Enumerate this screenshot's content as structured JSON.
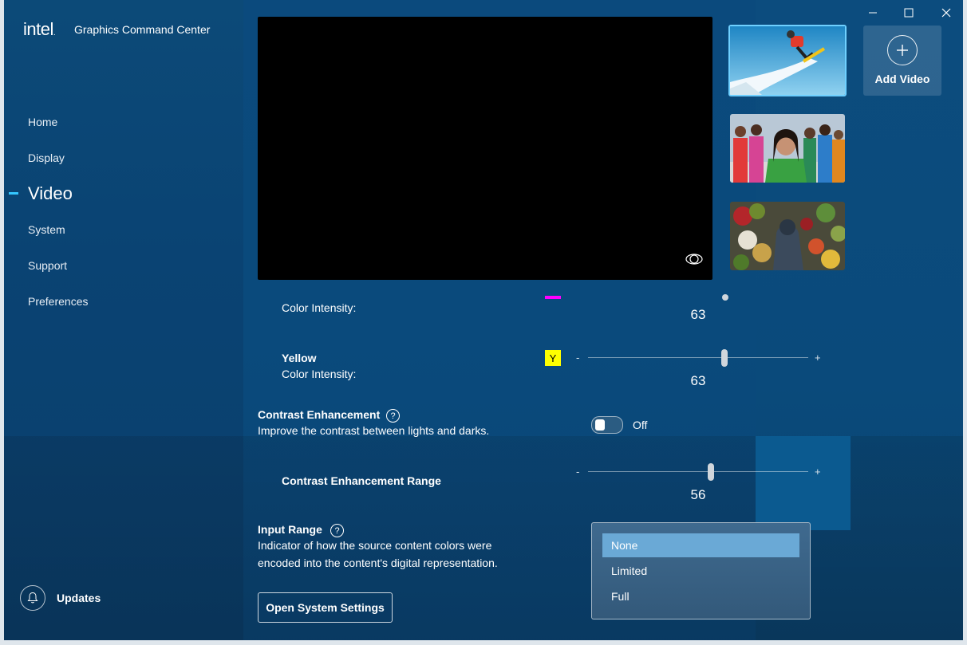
{
  "app": {
    "logo": "intel",
    "title": "Graphics Command Center"
  },
  "nav": {
    "items": [
      {
        "label": "Home"
      },
      {
        "label": "Display"
      },
      {
        "label": "Video"
      },
      {
        "label": "System"
      },
      {
        "label": "Support"
      },
      {
        "label": "Preferences"
      }
    ],
    "active": "Video"
  },
  "updates": {
    "label": "Updates",
    "icon": "bell-icon"
  },
  "window_controls": {
    "minimize": "–",
    "maximize": "□",
    "close": "✕"
  },
  "preview": {
    "icon": "eye-icon"
  },
  "thumbnails": [
    {
      "name": "snowboarder",
      "selected": true
    },
    {
      "name": "group-of-people",
      "selected": false
    },
    {
      "name": "market-vendor",
      "selected": false
    }
  ],
  "add_video": {
    "label": "Add Video",
    "icon": "plus-icon"
  },
  "magenta": {
    "intensity_label": "Color Intensity:",
    "value": "63",
    "slider_fraction": 0.63,
    "color": "#ff00ff"
  },
  "yellow": {
    "name": "Yellow",
    "intensity_label": "Color Intensity:",
    "swatch_letter": "Y",
    "value": "63",
    "slider_fraction": 0.63,
    "minus": "-",
    "plus": "+",
    "color": "#ffff00"
  },
  "contrast_enhancement": {
    "title": "Contrast Enhancement",
    "help": "?",
    "description": "Improve the contrast between lights and darks.",
    "toggle_state": "Off"
  },
  "contrast_range": {
    "title": "Contrast Enhancement Range",
    "value": "56",
    "slider_fraction": 0.56,
    "minus": "-",
    "plus": "+"
  },
  "input_range": {
    "title": "Input Range",
    "help": "?",
    "description_line1": "Indicator of how the source content colors were",
    "description_line2": "encoded into the content's digital representation.",
    "options": [
      {
        "label": "None",
        "selected": true
      },
      {
        "label": "Limited",
        "selected": false
      },
      {
        "label": "Full",
        "selected": false
      }
    ]
  },
  "open_system_settings": {
    "label": "Open System Settings"
  }
}
